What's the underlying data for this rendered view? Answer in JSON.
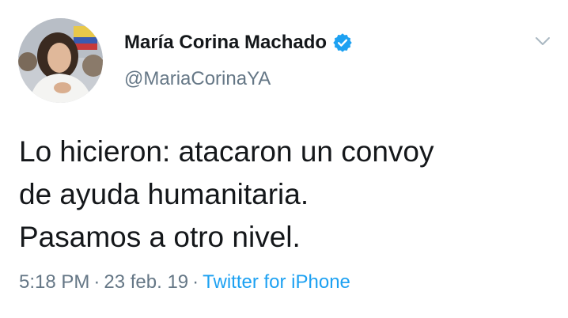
{
  "author": {
    "display_name": "María Corina Machado",
    "handle": "@MariaCorinaYA",
    "verified": true,
    "avatar_icon": "profile-photo"
  },
  "tweet": {
    "lines": [
      "Lo hicieron: atacaron un convoy",
      "de ayuda humanitaria.",
      "Pasamos a otro nivel."
    ]
  },
  "meta": {
    "time": "5:18 PM",
    "separator": "·",
    "date": "23 feb. 19",
    "source": "Twitter for iPhone"
  },
  "colors": {
    "text": "#14171a",
    "secondary": "#657786",
    "link": "#1da1f2",
    "verified_badge": "#1da1f2"
  },
  "icons": {
    "verified": "verified-badge-icon",
    "menu": "chevron-down-icon"
  }
}
